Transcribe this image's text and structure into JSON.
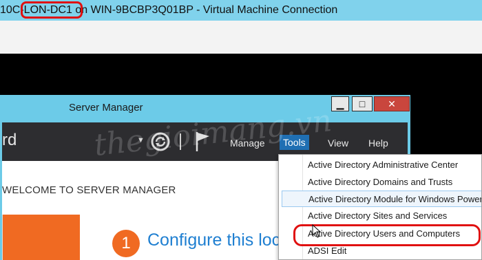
{
  "vm_window": {
    "title": "10C-LON-DC1 on WIN-9BCBP3Q01BP - Virtual Machine Connection"
  },
  "server_manager": {
    "window_title": "Server Manager",
    "window_buttons": {
      "minimize": "▁",
      "maximize": "□",
      "close": "✕"
    },
    "header": {
      "title": "rd",
      "menu": {
        "manage": "Manage",
        "tools": "Tools",
        "view": "View",
        "help": "Help"
      }
    },
    "content": {
      "welcome_heading": "WELCOME TO SERVER MANAGER",
      "step_number": "1",
      "step_text": "Configure this loc"
    }
  },
  "tools_menu": {
    "items": [
      "Active Directory Administrative Center",
      "Active Directory Domains and Trusts",
      "Active Directory Module for Windows PowerShell",
      "Active Directory Sites and Services",
      "Active Directory Users and Computers",
      "ADSI Edit"
    ]
  },
  "watermark": "thegioimang.vn",
  "colors": {
    "vm_titlebar": "#80d2ec",
    "sm_frame": "#6ccbe8",
    "sm_header": "#2d2d30",
    "accent_orange": "#f06a22",
    "link_blue": "#1f7fd1",
    "highlight_red": "#e01010"
  }
}
